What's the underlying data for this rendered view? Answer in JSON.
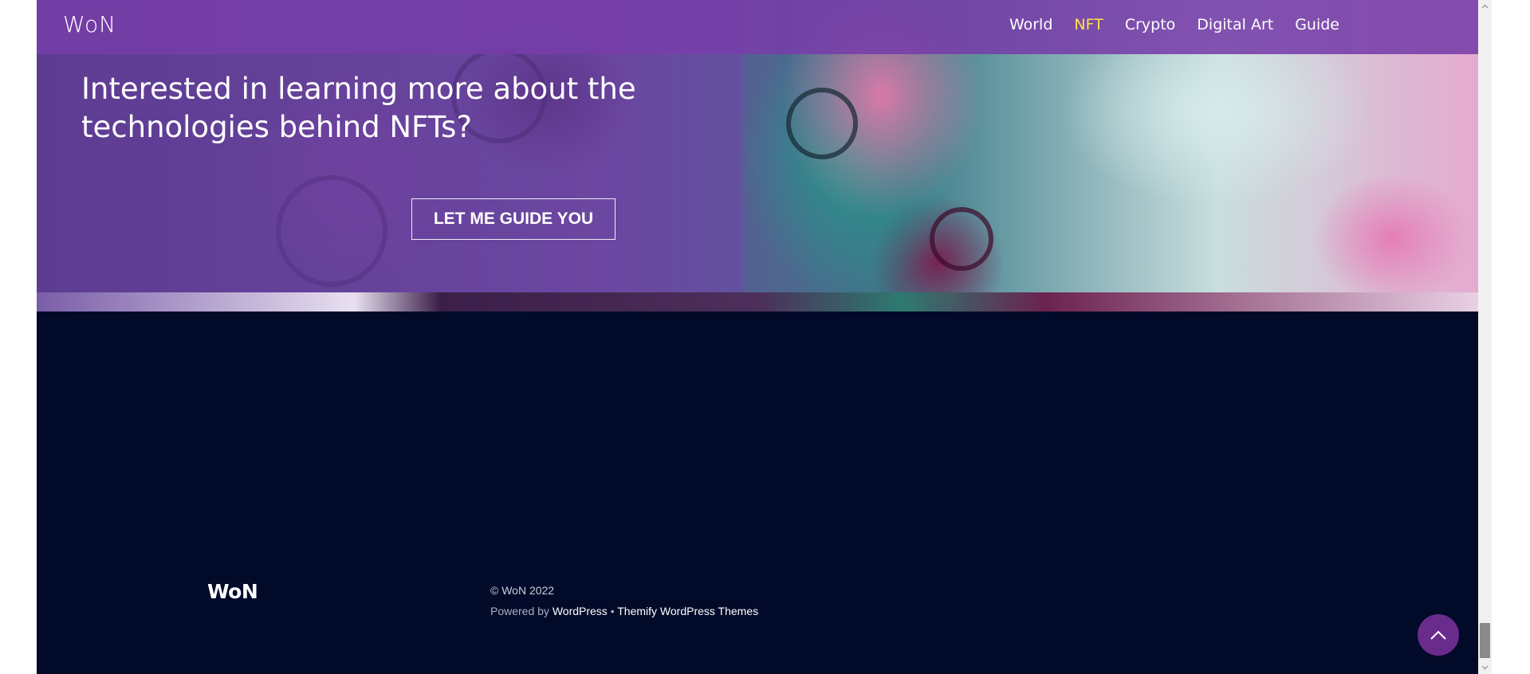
{
  "header": {
    "logo": "WoN",
    "nav": [
      {
        "label": "World",
        "active": false
      },
      {
        "label": "NFT",
        "active": true
      },
      {
        "label": "Crypto",
        "active": false
      },
      {
        "label": "Digital Art",
        "active": false
      },
      {
        "label": "Guide",
        "active": false
      }
    ],
    "background": "#763ea8",
    "active_color": "#ffe14a"
  },
  "hero": {
    "title": "Interested in learning more about the technologies behind NFTs?",
    "button_label": "LET ME GUIDE YOU"
  },
  "footer": {
    "logo": "WoN",
    "copyright": "© WoN 2022",
    "powered_prefix": "Powered by",
    "powered_link": "WordPress",
    "separator": "•",
    "theme_link": "Themify WordPress Themes",
    "background": "#010a29"
  },
  "back_to_top": {
    "icon": "chevron-up-icon",
    "color": "#6a2c8c"
  },
  "scrollbar": {
    "icons": [
      "scroll-up-arrow-icon",
      "scroll-down-arrow-icon"
    ]
  }
}
